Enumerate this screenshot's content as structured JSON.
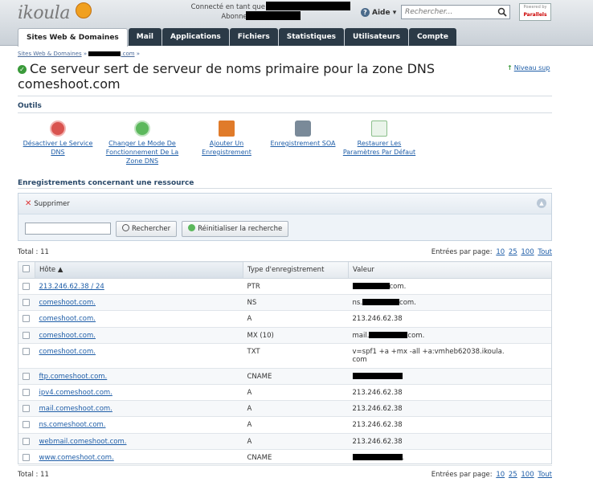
{
  "header": {
    "logo": "ikoula",
    "connected_label": "Connecté en tant que",
    "subscription_label": "Abonnement",
    "help_label": "Aide",
    "search_placeholder": "Rechercher...",
    "parallels_top": "Powered by",
    "parallels_brand": "Parallels"
  },
  "tabs": [
    {
      "label": "Sites Web & Domaines"
    },
    {
      "label": "Mail"
    },
    {
      "label": "Applications"
    },
    {
      "label": "Fichiers"
    },
    {
      "label": "Statistiques"
    },
    {
      "label": "Utilisateurs"
    },
    {
      "label": "Compte"
    }
  ],
  "breadcrumb": {
    "root": "Sites Web & Domaines",
    "sep": "»",
    "tail": ".com"
  },
  "page": {
    "title": "Ce serveur sert de serveur de noms primaire pour la zone DNS comeshoot.com",
    "up_label": "Niveau sup"
  },
  "tools": {
    "heading": "Outils",
    "items": [
      {
        "label": "Désactiver Le Service DNS",
        "icon": "stop-icon",
        "color": "#d9534f"
      },
      {
        "label": "Changer Le Mode De Fonctionnement De La Zone DNS",
        "icon": "refresh-icon",
        "color": "#5cb85c"
      },
      {
        "label": "Ajouter Un Enregistrement",
        "icon": "flag-add-icon",
        "color": "#e07b2a"
      },
      {
        "label": "Enregistrement SOA",
        "icon": "settings-icon",
        "color": "#7a8a99"
      },
      {
        "label": "Restaurer Les Paramètres Par Défaut",
        "icon": "check-doc-icon",
        "color": "#5cb85c"
      }
    ]
  },
  "records_heading": "Enregistrements concernant une ressource",
  "filter": {
    "delete_label": "Supprimer",
    "search_value": "",
    "search_button": "Rechercher",
    "reset_button": "Réinitialiser la recherche"
  },
  "total_label": "Total : 11",
  "perpage": {
    "label": "Entrées par page:",
    "options": [
      "10",
      "25",
      "100",
      "Tout"
    ]
  },
  "table": {
    "headers": [
      "Hôte",
      "Type d'enregistrement",
      "Valeur"
    ],
    "sort_arrow": "▲",
    "rows": [
      {
        "host": "213.246.62.38 / 24",
        "type": "PTR",
        "value_pre": "",
        "value_post": "com."
      },
      {
        "host": "comeshoot.com.",
        "type": "NS",
        "value_pre": "ns.",
        "value_post": "com."
      },
      {
        "host": "comeshoot.com.",
        "type": "A",
        "value_pre": "213.246.62.38",
        "value_post": ""
      },
      {
        "host": "comeshoot.com.",
        "type": "MX (10)",
        "value_pre": "mail.",
        "value_post": "com."
      },
      {
        "host": "comeshoot.com.",
        "type": "TXT",
        "value_pre": "v=spf1 +a +mx -all +a:vmheb62038.ikoula.",
        "value_post": "com"
      },
      {
        "host": "ftp.comeshoot.com.",
        "type": "CNAME",
        "value_pre": "",
        "value_post": ""
      },
      {
        "host": "ipv4.comeshoot.com.",
        "type": "A",
        "value_pre": "213.246.62.38",
        "value_post": ""
      },
      {
        "host": "mail.comeshoot.com.",
        "type": "A",
        "value_pre": "213.246.62.38",
        "value_post": ""
      },
      {
        "host": "ns.comeshoot.com.",
        "type": "A",
        "value_pre": "213.246.62.38",
        "value_post": ""
      },
      {
        "host": "webmail.comeshoot.com.",
        "type": "A",
        "value_pre": "213.246.62.38",
        "value_post": ""
      },
      {
        "host": "www.comeshoot.com.",
        "type": "CNAME",
        "value_pre": "",
        "value_post": "."
      }
    ]
  }
}
